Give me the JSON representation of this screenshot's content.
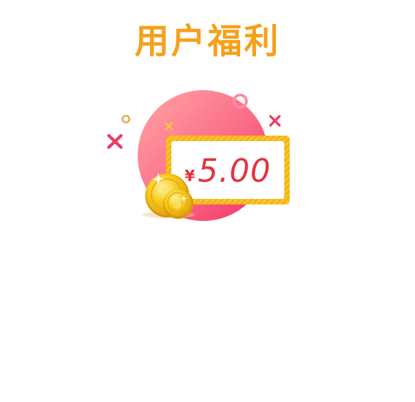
{
  "header": {
    "title": "用户福利"
  },
  "reward": {
    "currency_symbol": "¥",
    "amount": "5.00"
  },
  "colors": {
    "title": "#f5a11c",
    "amount": "#e3343e",
    "circle_light": "#ff9aa2",
    "circle_dark": "#f23a6a",
    "frame": "#f9c01e",
    "coin": "#f6c21a"
  },
  "icons": {
    "coin_front": "yen-coin-icon",
    "coin_back": "dollar-coin-icon"
  }
}
